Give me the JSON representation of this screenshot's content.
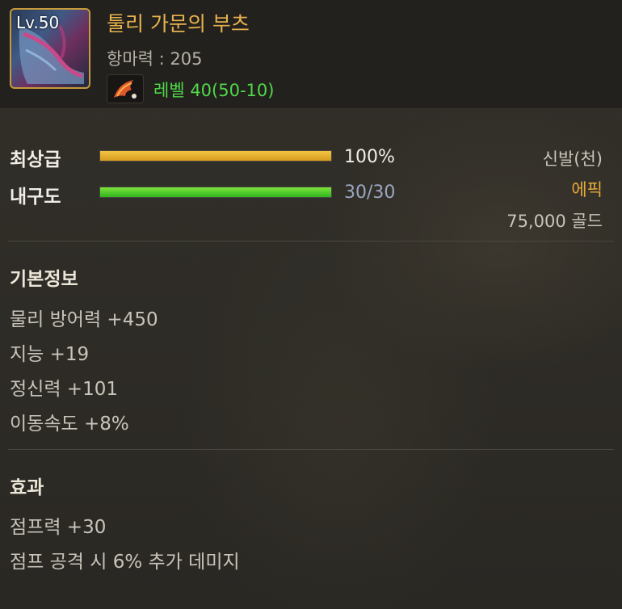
{
  "item": {
    "level_badge": "Lv.50",
    "name": "툴리 가문의 부츠",
    "main_stat": "항마력 : 205",
    "requirement": "레벨 40(50-10)"
  },
  "bars": {
    "grade_label": "최상급",
    "grade_value": "100%",
    "grade_fraction": 1.0,
    "durability_label": "내구도",
    "durability_value": "30/30",
    "durability_fraction": 1.0
  },
  "meta": {
    "slot": "신발(천)",
    "rarity": "에픽",
    "price": "75,000 골드"
  },
  "basic_info": {
    "title": "기본정보",
    "lines": [
      "물리 방어력 +450",
      "지능 +19",
      "정신력 +101",
      "이동속도 +8%"
    ]
  },
  "effects": {
    "title": "효과",
    "lines": [
      "점프력 +30",
      "점프 공격 시 6% 추가 데미지"
    ]
  },
  "colors": {
    "name": "#e7b24d",
    "requirement": "#4fd84a",
    "rarity": "#e7a93a",
    "grade_bar": "#e8b22e",
    "durability_bar": "#4fd02a"
  },
  "icons": {
    "item": "boots-icon",
    "requirement": "wing-feather-icon"
  }
}
